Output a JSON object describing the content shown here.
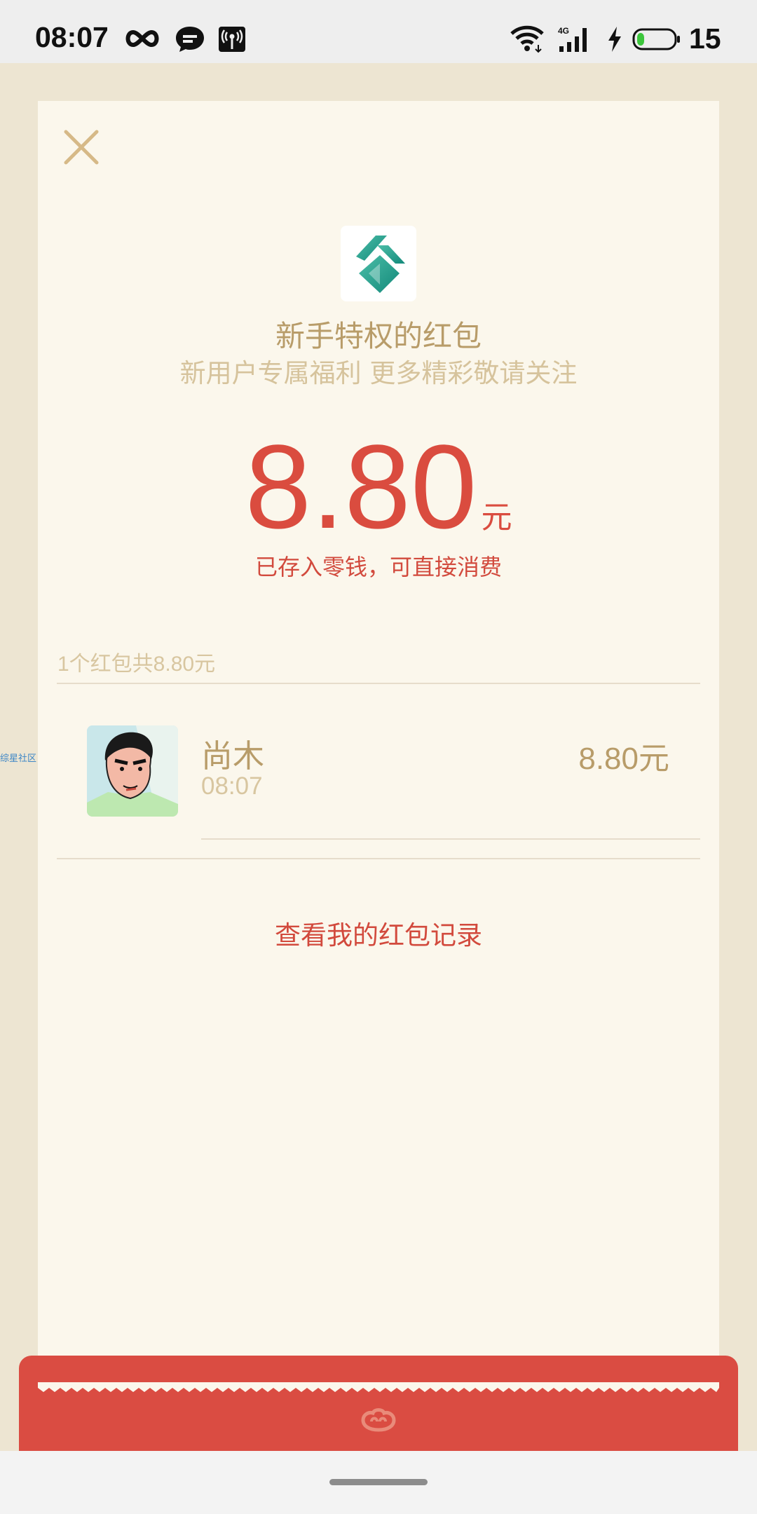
{
  "status_bar": {
    "time": "08:07",
    "battery_level": "15",
    "icons": [
      "infinity-icon",
      "chat-bubble-icon",
      "broadcast-icon",
      "wifi-icon",
      "signal-4g-icon",
      "charging-icon",
      "battery-icon"
    ]
  },
  "packet": {
    "title": "新手特权的红包",
    "subtitle": "新用户专属福利 更多精彩敬请关注",
    "amount": "8.80",
    "currency": "元",
    "note": "已存入零钱，可直接消费"
  },
  "summary": "1个红包共8.80元",
  "recipients": [
    {
      "name": "尚木",
      "time": "08:07",
      "amount": "8.80元"
    }
  ],
  "side_label": "综星社区",
  "record_link": "查看我的红包记录",
  "colors": {
    "accent_red": "#da4c3f",
    "gold_text": "#b89c69",
    "card_background": "#fbf7ec",
    "page_background": "#ede5d2"
  }
}
